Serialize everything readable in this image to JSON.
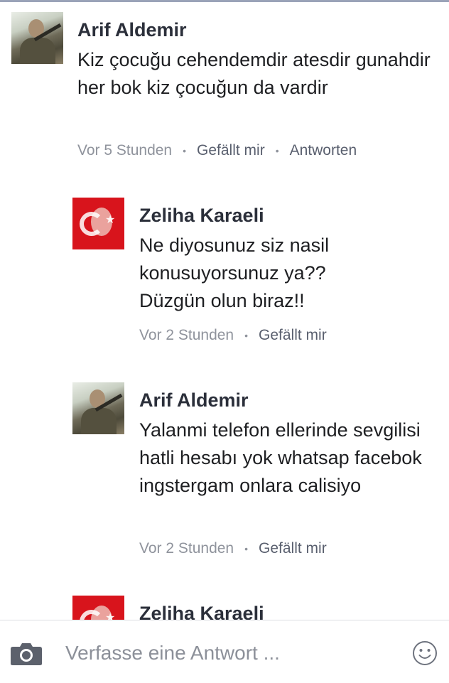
{
  "comments": [
    {
      "author": "Arif Aldemir",
      "text": "Kiz çocuğu cehendemdir atesdir gunahdir her bok kiz çocuğun da vardir",
      "time": "Vor 5 Stunden",
      "like_label": "Gefällt mir",
      "reply_label": "Antworten"
    },
    {
      "author": "Zeliha Karaeli",
      "text": "Ne diyosunuz siz nasil konusuyorsunuz ya?? Düzgün olun biraz!!",
      "time": "Vor 2 Stunden",
      "like_label": "Gefällt mir"
    },
    {
      "author": "Arif Aldemir",
      "text": "Yalanmi telefon ellerinde sevgilisi hatli hesabı yok whatsap facebok ingstergam onlara calisiyo",
      "time": "Vor 2 Stunden",
      "like_label": "Gefällt mir"
    },
    {
      "author": "Zeliha Karaeli"
    }
  ],
  "composer": {
    "placeholder": "Verfasse eine Antwort ...",
    "camera_icon": "camera-icon",
    "emoji_icon": "smiley-icon"
  },
  "colors": {
    "name": "#2b2f3a",
    "meta": "#8f939c",
    "action": "#595f6e",
    "flag_red": "#d8141c"
  }
}
